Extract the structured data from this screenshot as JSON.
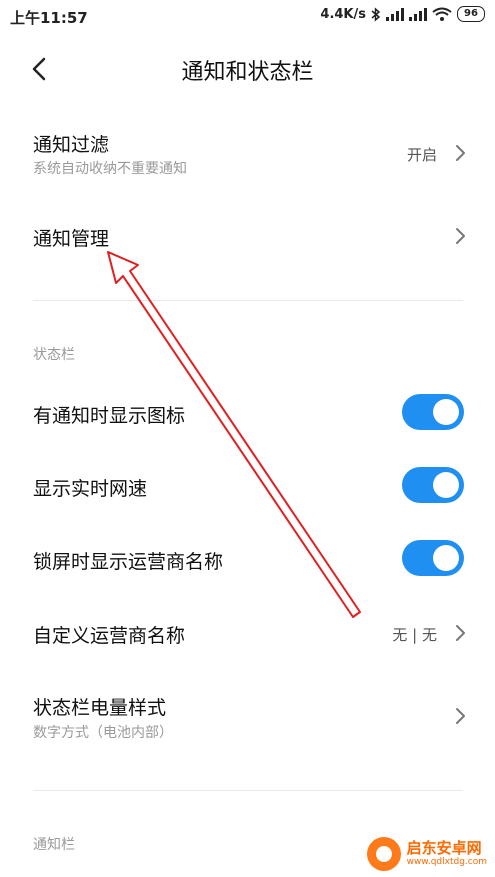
{
  "status_bar": {
    "time": "上午11:57",
    "net_speed": "4.4K/s",
    "battery": "96"
  },
  "header": {
    "title": "通知和状态栏"
  },
  "notification_filter": {
    "title": "通知过滤",
    "subtitle": "系统自动收纳不重要通知",
    "value": "开启"
  },
  "notification_manage": {
    "title": "通知管理"
  },
  "status_bar_section": {
    "label": "状态栏",
    "items": [
      {
        "title": "有通知时显示图标",
        "enabled": true
      },
      {
        "title": "显示实时网速",
        "enabled": true
      },
      {
        "title": "锁屏时显示运营商名称",
        "enabled": true
      }
    ]
  },
  "carrier_name": {
    "title": "自定义运营商名称",
    "value": "无 | 无"
  },
  "battery_style": {
    "title": "状态栏电量样式",
    "subtitle": "数字方式（电池内部）"
  },
  "notification_bar_section": {
    "label": "通知栏"
  },
  "colors": {
    "toggle_on": "#1f8ff2",
    "annotation_arrow": "#e02020"
  },
  "watermark": {
    "main": "启东安卓网",
    "url": "www.qdlxtdg.com"
  }
}
